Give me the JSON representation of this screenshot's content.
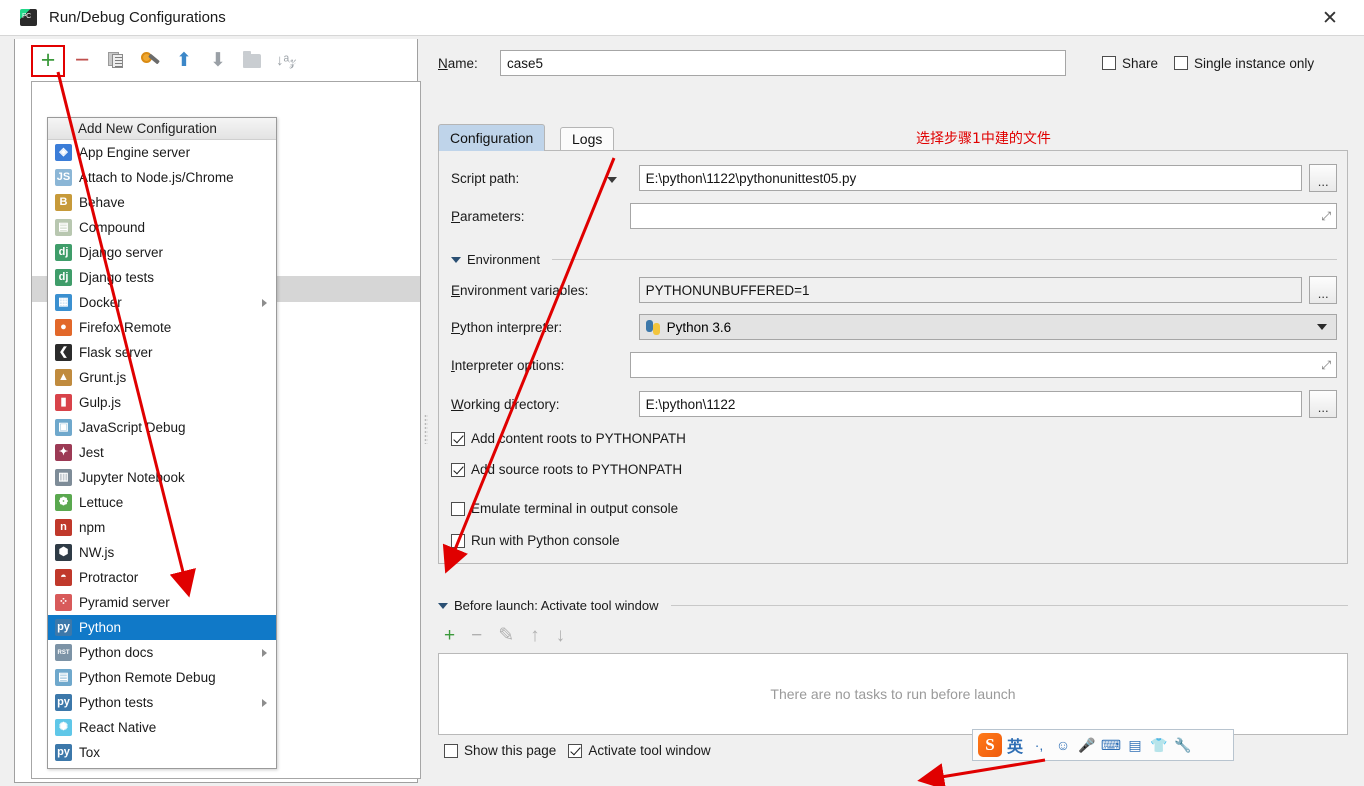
{
  "window": {
    "title": "Run/Debug Configurations",
    "icon": "pycharm-icon",
    "close_label": "✕"
  },
  "toolbar": {
    "items": [
      {
        "name": "add-configuration-button",
        "glyph": "+",
        "highlighted": true
      },
      {
        "name": "remove-configuration-button",
        "glyph": "−",
        "highlighted": false
      },
      {
        "name": "copy-configuration-button",
        "glyph": "copy-icon",
        "highlighted": false
      },
      {
        "name": "edit-templates-button",
        "glyph": "wrench-icon",
        "highlighted": false
      },
      {
        "name": "move-up-button",
        "glyph": "↑",
        "highlighted": false
      },
      {
        "name": "move-down-button",
        "glyph": "↓",
        "highlighted": false
      },
      {
        "name": "move-into-folder-button",
        "glyph": "folder-icon",
        "highlighted": false
      },
      {
        "name": "sort-configurations-button",
        "glyph": "sort-az-icon",
        "highlighted": false
      }
    ]
  },
  "dropdown": {
    "header": "Add New Configuration",
    "items": [
      {
        "label": "App Engine server",
        "icon": "app-engine-icon",
        "color": "#3b7dd8",
        "glyph": "◈",
        "submenu": false,
        "selected": false
      },
      {
        "label": "Attach to Node.js/Chrome",
        "icon": "nodejs-attach-icon",
        "color": "#8bb6d6",
        "glyph": "JS",
        "submenu": false,
        "selected": false
      },
      {
        "label": "Behave",
        "icon": "behave-icon",
        "color": "#c79a3a",
        "glyph": "B",
        "submenu": false,
        "selected": false
      },
      {
        "label": "Compound",
        "icon": "compound-icon",
        "color": "#b8c7b0",
        "glyph": "▤",
        "submenu": false,
        "selected": false
      },
      {
        "label": "Django server",
        "icon": "django-icon",
        "color": "#3f9d6a",
        "glyph": "dj",
        "submenu": false,
        "selected": false
      },
      {
        "label": "Django tests",
        "icon": "django-tests-icon",
        "color": "#3f9d6a",
        "glyph": "dj",
        "submenu": false,
        "selected": false
      },
      {
        "label": "Docker",
        "icon": "docker-icon",
        "color": "#3b90d0",
        "glyph": "▦",
        "submenu": true,
        "selected": false
      },
      {
        "label": "Firefox Remote",
        "icon": "firefox-icon",
        "color": "#e2682a",
        "glyph": "●",
        "submenu": false,
        "selected": false
      },
      {
        "label": "Flask server",
        "icon": "flask-icon",
        "color": "#2b2b2b",
        "glyph": "❮",
        "submenu": false,
        "selected": false
      },
      {
        "label": "Grunt.js",
        "icon": "grunt-icon",
        "color": "#c08b3e",
        "glyph": "▲",
        "submenu": false,
        "selected": false
      },
      {
        "label": "Gulp.js",
        "icon": "gulp-icon",
        "color": "#d8434a",
        "glyph": "▮",
        "submenu": false,
        "selected": false
      },
      {
        "label": "JavaScript Debug",
        "icon": "javascript-debug-icon",
        "color": "#6fa8cc",
        "glyph": "▣",
        "submenu": false,
        "selected": false
      },
      {
        "label": "Jest",
        "icon": "jest-icon",
        "color": "#9c3a55",
        "glyph": "✦",
        "submenu": false,
        "selected": false
      },
      {
        "label": "Jupyter Notebook",
        "icon": "jupyter-icon",
        "color": "#7e8c98",
        "glyph": "▥",
        "submenu": false,
        "selected": false
      },
      {
        "label": "Lettuce",
        "icon": "lettuce-icon",
        "color": "#5aa84f",
        "glyph": "❁",
        "submenu": false,
        "selected": false
      },
      {
        "label": "npm",
        "icon": "npm-icon",
        "color": "#c0392b",
        "glyph": "n",
        "submenu": false,
        "selected": false
      },
      {
        "label": "NW.js",
        "icon": "nwjs-icon",
        "color": "#2f3b46",
        "glyph": "⬢",
        "submenu": false,
        "selected": false
      },
      {
        "label": "Protractor",
        "icon": "protractor-icon",
        "color": "#c0392b",
        "glyph": "◓",
        "submenu": false,
        "selected": false
      },
      {
        "label": "Pyramid server",
        "icon": "pyramid-icon",
        "color": "#d85a5a",
        "glyph": "⁘",
        "submenu": false,
        "selected": false
      },
      {
        "label": "Python",
        "icon": "python-icon",
        "color": "#3c78aa",
        "glyph": "py",
        "submenu": false,
        "selected": true
      },
      {
        "label": "Python docs",
        "icon": "python-docs-icon",
        "color": "#7c93a6",
        "glyph": "RST",
        "submenu": true,
        "selected": false
      },
      {
        "label": "Python Remote Debug",
        "icon": "python-remote-debug-icon",
        "color": "#6fa8cc",
        "glyph": "▤",
        "submenu": false,
        "selected": false
      },
      {
        "label": "Python tests",
        "icon": "python-tests-icon",
        "color": "#3c78aa",
        "glyph": "py",
        "submenu": true,
        "selected": false
      },
      {
        "label": "React Native",
        "icon": "react-native-icon",
        "color": "#5fc7e8",
        "glyph": "✺",
        "submenu": false,
        "selected": false
      },
      {
        "label": "Tox",
        "icon": "tox-icon",
        "color": "#3c78aa",
        "glyph": "py",
        "submenu": false,
        "selected": false
      }
    ]
  },
  "form": {
    "name_label": "Name:",
    "name_value": "case5",
    "share_label": "Share",
    "share_checked": false,
    "single_instance_label": "Single instance only",
    "single_instance_checked": false,
    "tabs": [
      {
        "label": "Configuration",
        "active": true
      },
      {
        "label": "Logs",
        "active": false
      }
    ],
    "script_path_label": "Script path:",
    "script_path_value": "E:\\python\\1122\\pythonunittest05.py",
    "browse_label": "...",
    "parameters_label": "Parameters:",
    "parameters_value": "",
    "environment_section": "Environment",
    "env_vars_label": "Environment variables:",
    "env_vars_value": "PYTHONUNBUFFERED=1",
    "interpreter_label": "Python interpreter:",
    "interpreter_value": "Python 3.6",
    "interpreter_options_label": "Interpreter options:",
    "interpreter_options_value": "",
    "working_dir_label": "Working directory:",
    "working_dir_value": "E:\\python\\1122",
    "checkboxes": [
      {
        "label": "Add content roots to PYTHONPATH",
        "checked": true,
        "name": "add-content-roots-checkbox"
      },
      {
        "label": "Add source roots to PYTHONPATH",
        "checked": true,
        "name": "add-source-roots-checkbox"
      },
      {
        "label": "Emulate terminal in output console",
        "checked": false,
        "name": "emulate-terminal-checkbox"
      },
      {
        "label": "Run with Python console",
        "checked": false,
        "name": "run-with-python-console-checkbox"
      }
    ],
    "before_launch_label": "Before launch: Activate tool window",
    "before_launch_empty": "There are no tasks to run before launch",
    "before_launch_tools": [
      {
        "name": "add-task-button",
        "glyph": "+",
        "color": "#3c9a3c"
      },
      {
        "name": "remove-task-button",
        "glyph": "−",
        "color": "#b0b0b0"
      },
      {
        "name": "edit-task-button",
        "glyph": "✎",
        "color": "#b0b0b0"
      },
      {
        "name": "move-task-up-button",
        "glyph": "↑",
        "color": "#b0b0b0"
      },
      {
        "name": "move-task-down-button",
        "glyph": "↓",
        "color": "#b0b0b0"
      }
    ],
    "show_page_label": "Show this page",
    "show_page_checked": false,
    "activate_tool_window_label": "Activate tool window",
    "activate_tool_window_checked": true
  },
  "annotations": {
    "note_text": "选择步骤1中建的文件",
    "note_color": "#e00000",
    "arrow_color": "#e00000"
  },
  "ime": {
    "logo": "S",
    "mode_label": "英",
    "icons": [
      {
        "name": "punctuation-icon",
        "glyph": "·,"
      },
      {
        "name": "emoji-icon",
        "glyph": "☺"
      },
      {
        "name": "voice-input-icon",
        "glyph": "🎤"
      },
      {
        "name": "soft-keyboard-icon",
        "glyph": "⌨"
      },
      {
        "name": "toolbox-icon",
        "glyph": "▤"
      },
      {
        "name": "skin-icon",
        "glyph": "👕"
      },
      {
        "name": "settings-wrench-icon",
        "glyph": "🔧"
      }
    ]
  }
}
